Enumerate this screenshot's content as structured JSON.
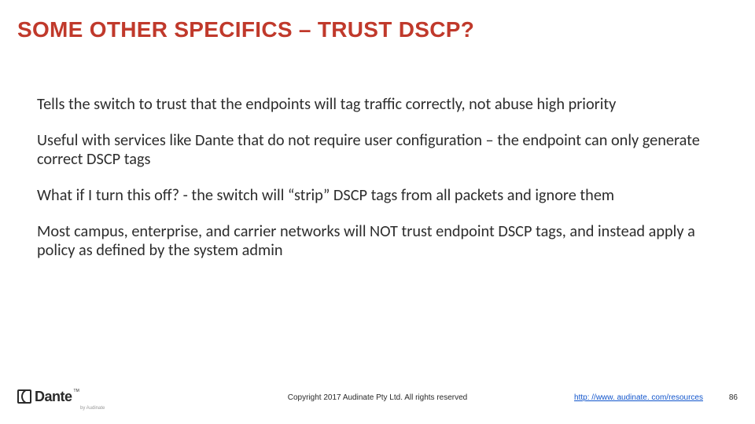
{
  "title": "SOME OTHER SPECIFICS – TRUST DSCP?",
  "paragraphs": {
    "p0": "Tells the switch to trust that the endpoints will tag traffic correctly, not abuse high priority",
    "p1": "Useful with services like Dante that do not require user configuration – the endpoint can only generate correct DSCP tags",
    "p2": "What if I turn this off? - the switch will “strip” DSCP tags from all packets and ignore them",
    "p3": "Most campus, enterprise, and carrier networks will NOT trust endpoint DSCP tags, and instead apply a policy as defined by the system admin"
  },
  "footer": {
    "logo_text": "Dante",
    "logo_tm": "TM",
    "logo_by": "by Audinate",
    "copyright": "Copyright 2017 Audinate Pty Ltd. All rights reserved",
    "url_text": "http: //www. audinate. com/resources",
    "url_href": "http://www.audinate.com/resources",
    "page_number": "86"
  }
}
